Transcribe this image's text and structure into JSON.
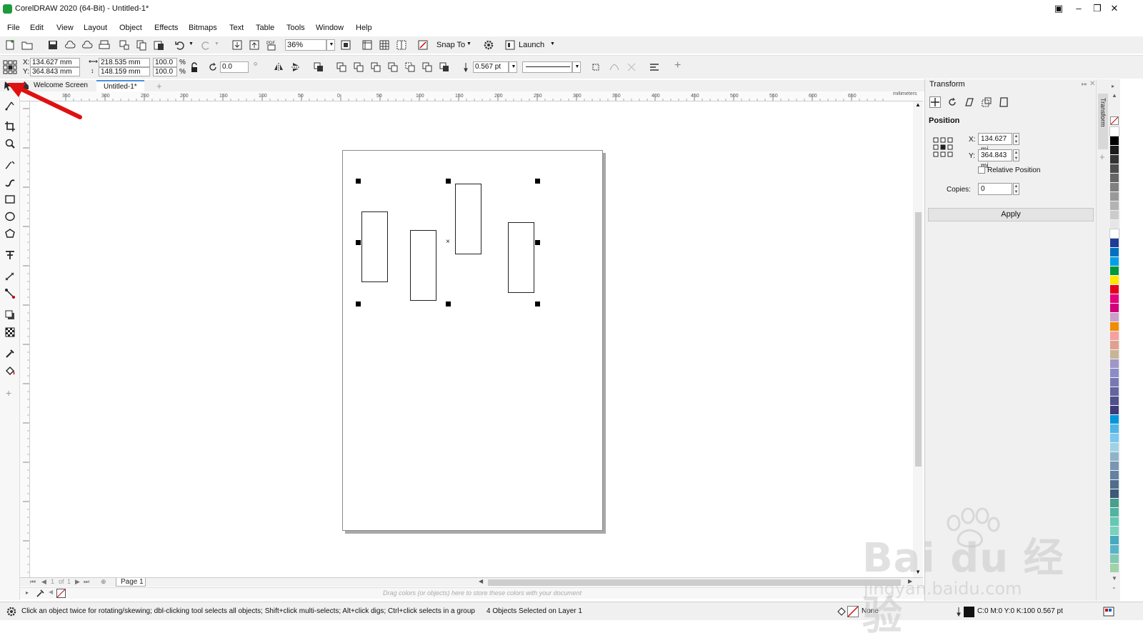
{
  "window": {
    "title": "CorelDRAW 2020 (64-Bit) - Untitled-1*"
  },
  "menu": [
    "File",
    "Edit",
    "View",
    "Layout",
    "Object",
    "Effects",
    "Bitmaps",
    "Text",
    "Table",
    "Tools",
    "Window",
    "Help"
  ],
  "standard_toolbar": {
    "zoom_value": "36%",
    "snap_to_label": "Snap To",
    "launch_label": "Launch"
  },
  "property_bar": {
    "x_label": "X:",
    "x_value": "134.627 mm",
    "y_label": "Y:",
    "y_value": "364.843 mm",
    "width_value": "218.535 mm",
    "height_value": "148.159 mm",
    "scale_x": "100.0",
    "scale_y": "100.0",
    "percent": "%",
    "rotation": "0.0",
    "outline_width": "0.567 pt"
  },
  "tabs": [
    {
      "label": "Welcome Screen"
    },
    {
      "label": "Untitled-1*"
    }
  ],
  "ruler": {
    "h_ticks": [
      "350",
      "300",
      "250",
      "200",
      "150",
      "100",
      "50",
      "0",
      "50",
      "100",
      "150",
      "200",
      "250",
      "300",
      "350",
      "400",
      "450",
      "500",
      "550",
      "600",
      "650"
    ],
    "unit": "millimeters"
  },
  "page_nav": {
    "page_of": "1",
    "of_label": "of",
    "total": "1",
    "page_tab": "Page 1"
  },
  "doc_palette_hint": "Drag colors (or objects) here to store these colors with your document",
  "status": {
    "hint": "Click an object twice for rotating/skewing; dbl-clicking tool selects all objects; Shift+click multi-selects; Alt+click digs; Ctrl+click selects in a group",
    "selection": "4 Objects Selected on Layer 1",
    "fill_label": "None",
    "outline_info": "C:0 M:0 Y:0 K:100  0.567 pt"
  },
  "docker": {
    "title": "Transform",
    "side_tab": "Transform",
    "section": "Position",
    "x_label": "X:",
    "x_value": "134.627 mi",
    "y_label": "Y:",
    "y_value": "364.843 mi",
    "relative_label": "Relative Position",
    "copies_label": "Copies:",
    "copies_value": "0",
    "apply_label": "Apply"
  },
  "palette_colors": [
    "#ffffff",
    "#000000",
    "#1a1a1a",
    "#333333",
    "#4d4d4d",
    "#666666",
    "#808080",
    "#999999",
    "#b3b3b3",
    "#cccccc",
    "#e6e6e6",
    "#ffffff",
    "#1e3c96",
    "#0070c0",
    "#00a0e6",
    "#00963c",
    "#ffe600",
    "#e6001e",
    "#e6007e",
    "#d2007a",
    "#c8a0c8",
    "#f08c00",
    "#f5a0a0",
    "#e0a090",
    "#c8b496",
    "#a096c8",
    "#8c8cc8",
    "#7878b4",
    "#6464a0",
    "#50508c",
    "#3c3c78",
    "#0096dc",
    "#50b4e6",
    "#78c8f0",
    "#a0d2e6",
    "#8cb4c8",
    "#7896b4",
    "#6482a0",
    "#506e8c",
    "#3c5a78",
    "#46a08c",
    "#50b4a0",
    "#64c8b4",
    "#78d2be",
    "#46aabe",
    "#5ab4c8",
    "#82c8b4",
    "#a0d2aa"
  ],
  "watermark": {
    "brand": "Bai du 经验",
    "url": "jingyan.baidu.com"
  }
}
